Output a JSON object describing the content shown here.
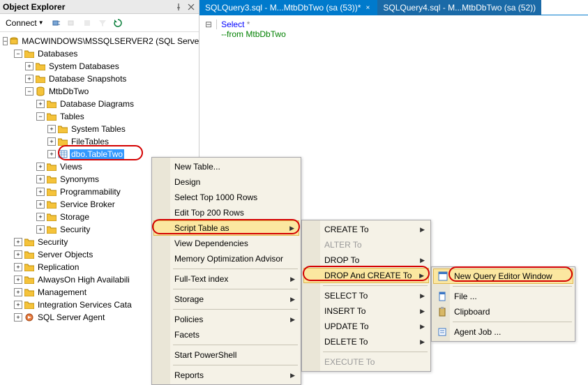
{
  "panel": {
    "title": "Object Explorer"
  },
  "toolbar": {
    "connect_label": "Connect"
  },
  "tree": {
    "server": "MACWINDOWS\\MSSQLSERVER2 (SQL Serve",
    "databases": "Databases",
    "system_db": "System Databases",
    "snapshots": "Database Snapshots",
    "db_name": "MtbDbTwo",
    "db_diagrams": "Database Diagrams",
    "tables": "Tables",
    "system_tables": "System Tables",
    "file_tables": "FileTables",
    "table_two": "dbo.TableTwo",
    "views": "Views",
    "synonyms": "Synonyms",
    "programmability": "Programmability",
    "service_broker": "Service Broker",
    "storage": "Storage",
    "security_inner": "Security",
    "security": "Security",
    "server_objects": "Server Objects",
    "replication": "Replication",
    "alwayson": "AlwaysOn High Availabili",
    "management": "Management",
    "integration": "Integration Services Cata",
    "agent": "SQL Server Agent"
  },
  "tabs": {
    "active": "SQLQuery3.sql - M...MtbDbTwo (sa (53))*",
    "inactive": "SQLQuery4.sql - M...MtbDbTwo (sa (52))"
  },
  "code": {
    "l1a": "Select",
    "l1b": "*",
    "l2": "--from MtbDbTwo"
  },
  "menu1": {
    "new_table": "New Table...",
    "design": "Design",
    "select_top": "Select Top 1000 Rows",
    "edit_top": "Edit Top 200 Rows",
    "script_table": "Script Table as",
    "view_deps": "View Dependencies",
    "mem_opt": "Memory Optimization Advisor",
    "fulltext": "Full-Text index",
    "storage": "Storage",
    "policies": "Policies",
    "facets": "Facets",
    "powershell": "Start PowerShell",
    "reports": "Reports"
  },
  "menu2": {
    "create_to": "CREATE To",
    "alter_to": "ALTER To",
    "drop_to": "DROP To",
    "drop_create_to": "DROP And CREATE To",
    "select_to": "SELECT To",
    "insert_to": "INSERT To",
    "update_to": "UPDATE To",
    "delete_to": "DELETE To",
    "execute_to": "EXECUTE To"
  },
  "menu3": {
    "new_query": "New Query Editor Window",
    "file": "File ...",
    "clipboard": "Clipboard",
    "agent_job": "Agent Job ..."
  }
}
